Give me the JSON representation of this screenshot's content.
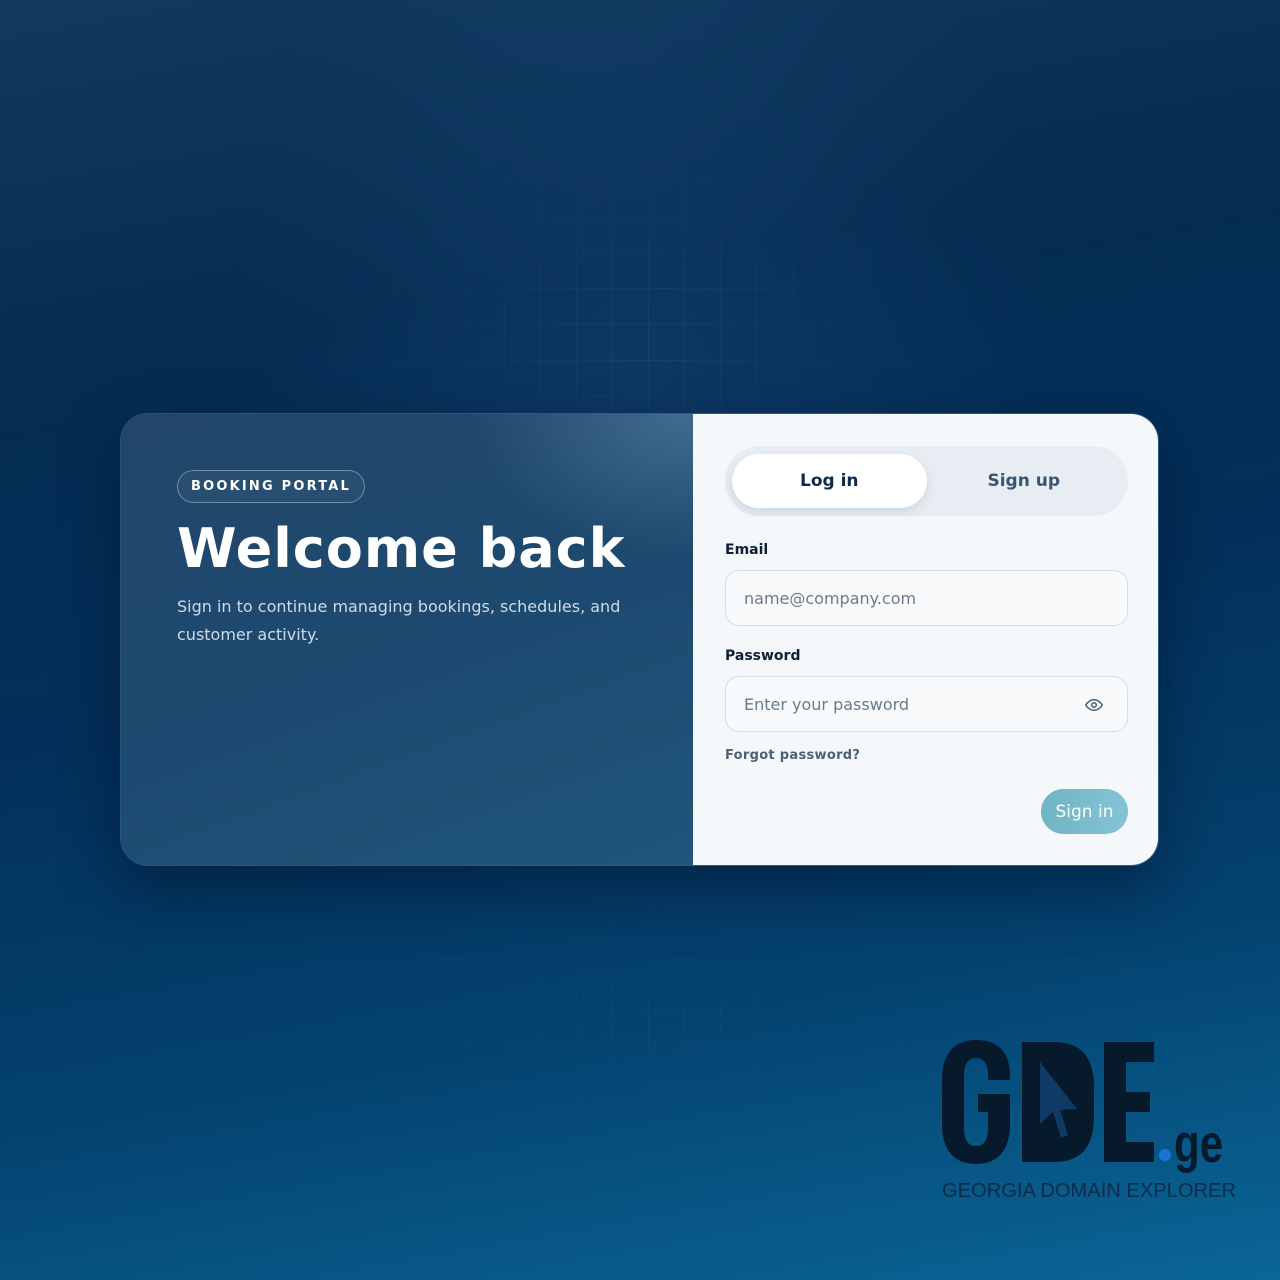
{
  "brand_panel": {
    "badge": "BOOKING PORTAL",
    "title": "Welcome back",
    "subtitle": "Sign in to continue managing bookings, schedules, and customer activity."
  },
  "tabs": {
    "login": "Log in",
    "signup": "Sign up",
    "active": "login"
  },
  "form": {
    "email_label": "Email",
    "email_placeholder": "name@company.com",
    "password_label": "Password",
    "password_placeholder": "Enter your password",
    "forgot_link": "Forgot password?",
    "submit_label": "Sign in"
  },
  "watermark": {
    "logo_text": "GDE",
    "logo_suffix": ".ge",
    "tagline": "GEORGIA DOMAIN EXPLORER"
  },
  "colors": {
    "accent": "#6fb5c5",
    "panel_dark": "#1d4a70",
    "form_bg": "#f5f8fb",
    "heading": "#0e2a4a"
  },
  "icons": {
    "password_toggle": "eye-icon"
  }
}
